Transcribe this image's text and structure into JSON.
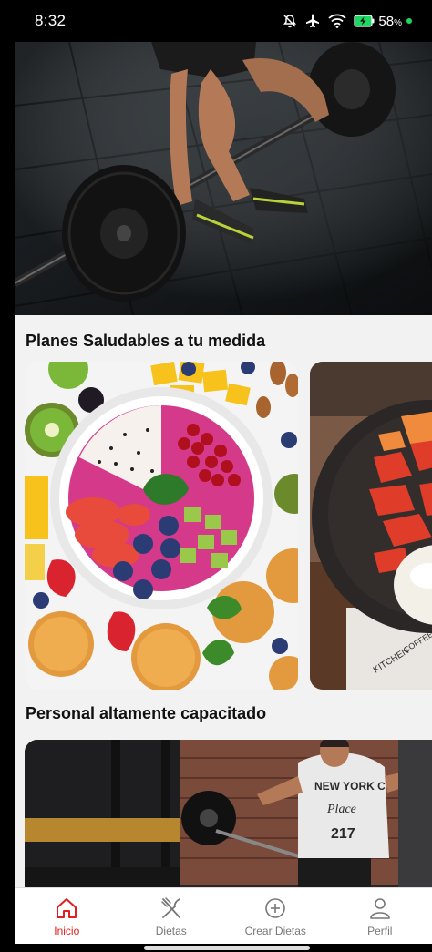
{
  "status_bar": {
    "time": "8:32",
    "battery_percent": "58",
    "battery_unit": "%",
    "icons": [
      "mute-icon",
      "airplane-mode-icon",
      "wifi-icon",
      "battery-charging-icon"
    ]
  },
  "sections": [
    {
      "title": "Planes Saludables a tu medida"
    },
    {
      "title": "Personal altamente capacitado"
    }
  ],
  "bottom_nav": {
    "items": [
      {
        "label": "Inicio",
        "icon": "home-icon",
        "active": true
      },
      {
        "label": "Dietas",
        "icon": "fork-knife-icon",
        "active": false
      },
      {
        "label": "Crear Dietas",
        "icon": "plus-circle-icon",
        "active": false
      },
      {
        "label": "Perfil",
        "icon": "user-icon",
        "active": false
      }
    ]
  },
  "colors": {
    "accent": "#e02020",
    "nav_inactive": "#777777",
    "background": "#f2f2f2"
  }
}
